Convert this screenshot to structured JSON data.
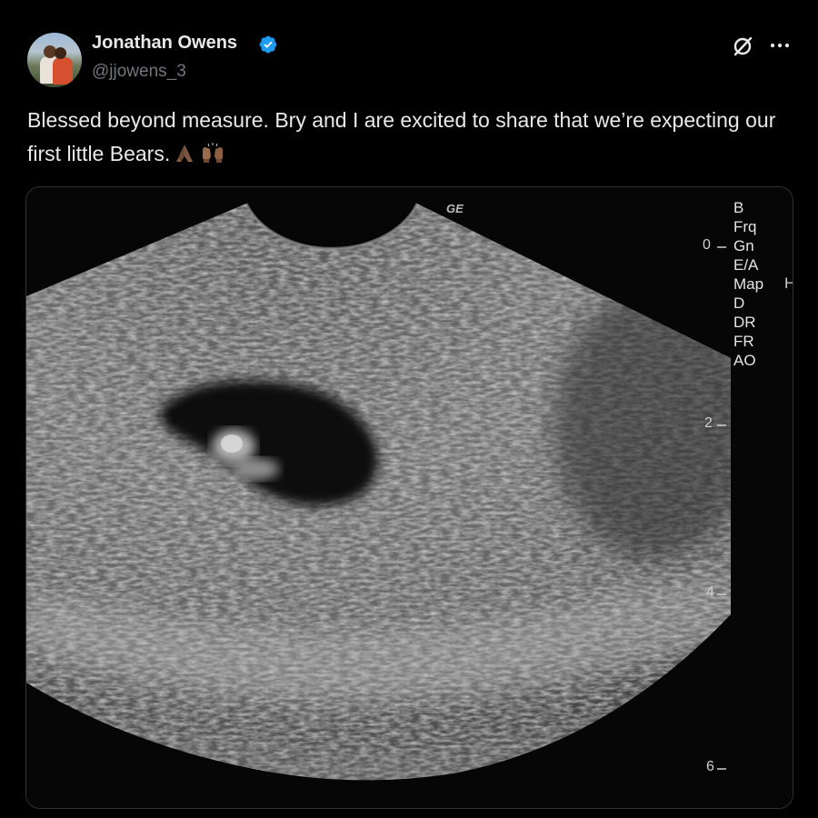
{
  "author": {
    "name": "Jonathan Owens",
    "handle": "@jjowens_3",
    "verified": true,
    "avatar_icon": "avatar-photo"
  },
  "actions": {
    "grok_icon": "grok-icon",
    "more_icon": "more-options-icon"
  },
  "post": {
    "text": "Blessed beyond measure. Bry and I are excited to share that we’re expecting our first little Bears.",
    "emojis": [
      "folded-hands-emoji",
      "raised-hands-emoji"
    ]
  },
  "media": {
    "ge_label": "GE",
    "parameters": [
      "B",
      "Frq",
      "Gn",
      "E/A",
      "Map",
      "D",
      "DR",
      "FR",
      "AO"
    ],
    "map_suffix": "H",
    "depth_marks": [
      "0",
      "2",
      "4",
      "6"
    ]
  },
  "colors": {
    "background": "#000000",
    "text": "#e7e9ea",
    "secondary_text": "#71767b",
    "verified_blue": "#1d9bf0"
  }
}
